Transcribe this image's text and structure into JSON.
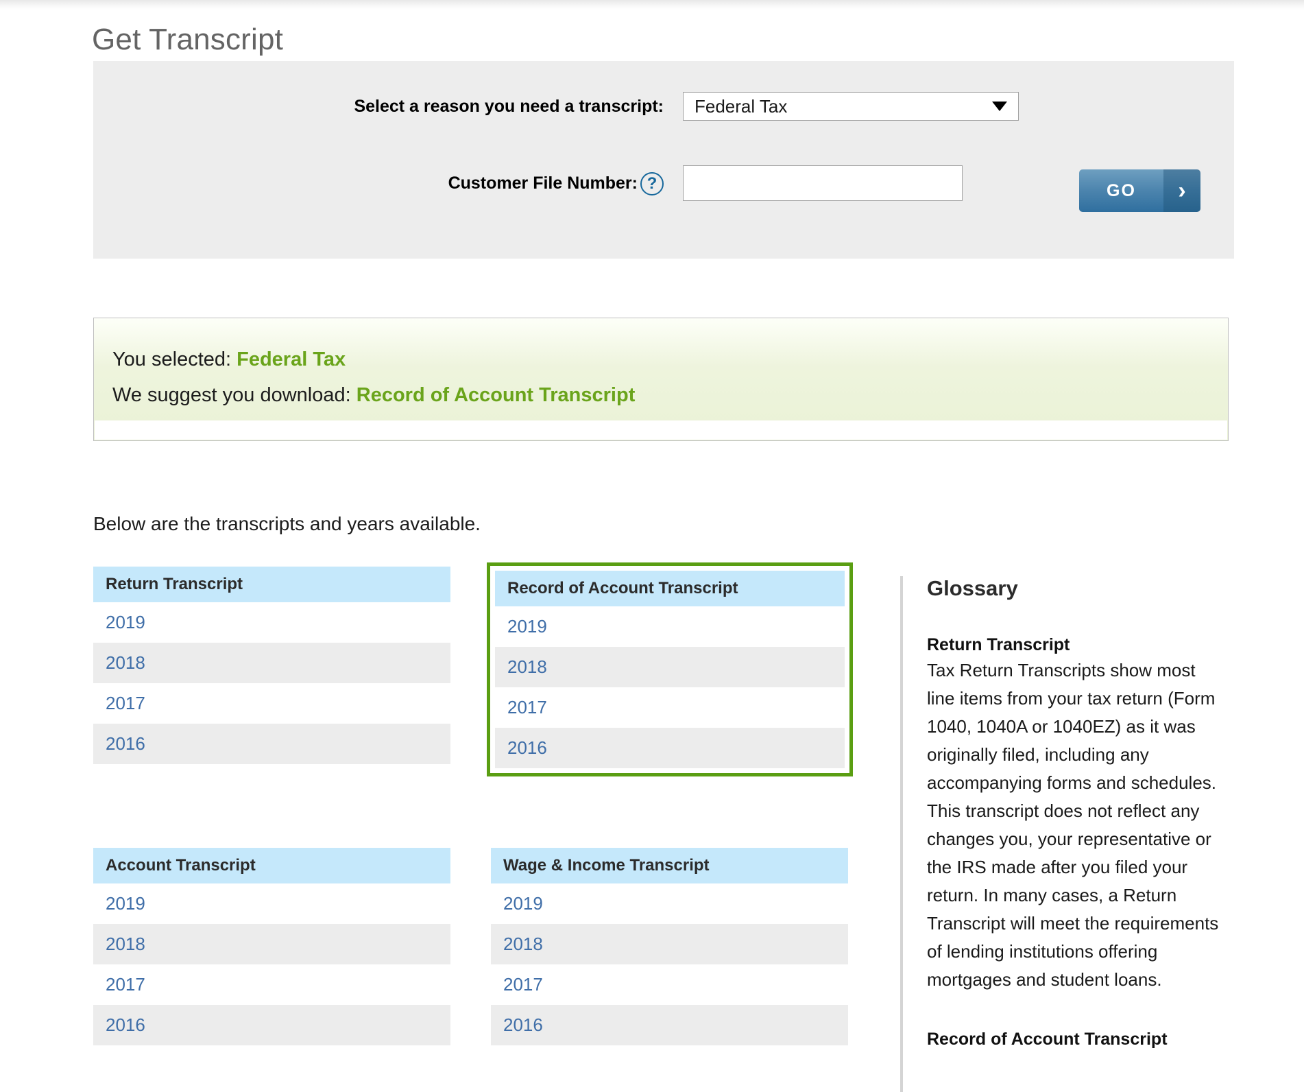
{
  "page": {
    "title": "Get Transcript"
  },
  "form": {
    "reason_label": "Select a reason you need a transcript:",
    "reason_selected": "Federal Tax",
    "reason_options": [
      "Federal Tax"
    ],
    "cfn_label": "Customer File Number:",
    "cfn_help_glyph": "?",
    "cfn_value": "",
    "cfn_placeholder": "",
    "go_label": "GO",
    "go_chevron_glyph": "›"
  },
  "suggestion": {
    "selected_prefix": "You selected: ",
    "selected_value": "Federal Tax",
    "suggest_prefix": "We suggest you download: ",
    "suggest_value": "Record of Account Transcript",
    "accent_color": "#6aa41b"
  },
  "below": {
    "intro": "Below are the transcripts and years available."
  },
  "cards": [
    {
      "title": "Return Transcript",
      "years": [
        "2019",
        "2018",
        "2017",
        "2016"
      ],
      "highlighted": false
    },
    {
      "title": "Record of Account Transcript",
      "years": [
        "2019",
        "2018",
        "2017",
        "2016"
      ],
      "highlighted": true
    },
    {
      "title": "Account Transcript",
      "years": [
        "2019",
        "2018",
        "2017",
        "2016"
      ],
      "highlighted": false
    },
    {
      "title": "Wage & Income Transcript",
      "years": [
        "2019",
        "2018",
        "2017",
        "2016"
      ],
      "highlighted": false
    }
  ],
  "glossary": {
    "heading": "Glossary",
    "entries": [
      {
        "term": "Return Transcript",
        "definition": "Tax Return Transcripts show most line items from your tax return (Form 1040, 1040A or 1040EZ) as it was originally filed, including any accompanying forms and schedules. This transcript does not reflect any changes you, your representative or the IRS made after you filed your return. In many cases, a Return Transcript will meet the requirements of lending institutions offering mortgages and student loans."
      },
      {
        "term": "Record of Account Transcript",
        "definition": ""
      }
    ]
  },
  "colors": {
    "card_header_blue": "#c5e8fb",
    "highlight_green": "#5a9e12",
    "link_blue": "#3f6ea8",
    "panel_gray": "#ededed"
  }
}
